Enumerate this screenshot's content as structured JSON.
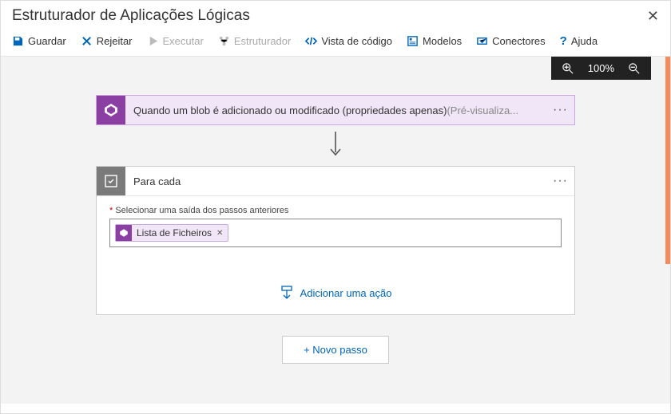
{
  "window": {
    "title": "Estruturador de Aplicações Lógicas"
  },
  "toolbar": {
    "save": "Guardar",
    "discard": "Rejeitar",
    "run": "Executar",
    "designer": "Estruturador",
    "codeview": "Vista de código",
    "templates": "Modelos",
    "connectors": "Conectores",
    "help": "Ajuda"
  },
  "zoom": {
    "level": "100%"
  },
  "trigger": {
    "label": "Quando um blob é adicionado ou modificado (propriedades apenas)",
    "suffix": "(Pré-visualiza..."
  },
  "foreach": {
    "title": "Para cada",
    "fieldLabel": "Selecionar uma saída dos passos anteriores",
    "token": "Lista de Ficheiros",
    "addAction": "Adicionar uma ação"
  },
  "newStep": "+ Novo passo"
}
